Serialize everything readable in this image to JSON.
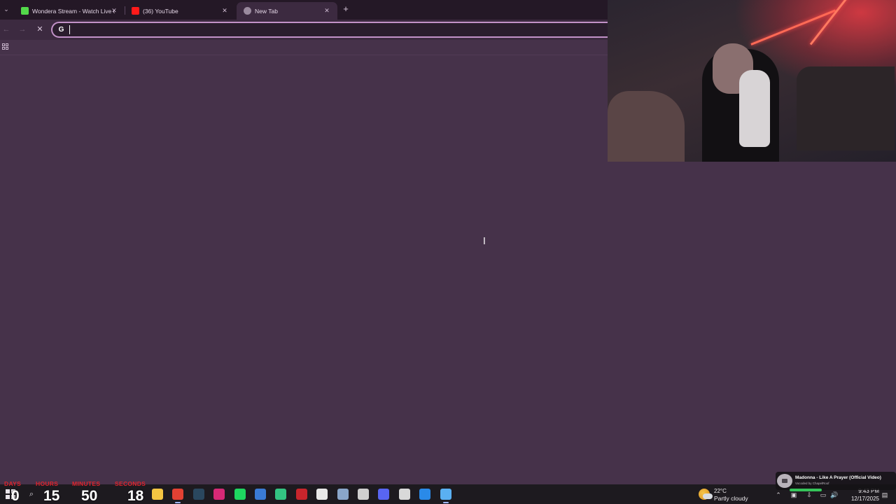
{
  "browser": {
    "tabs": [
      {
        "title": "Wondera Stream - Watch Live o",
        "active": false,
        "favicon_color": "#53d94a"
      },
      {
        "title": "(36) YouTube",
        "active": false,
        "favicon_color": "#ff1a1a"
      },
      {
        "title": "New Tab",
        "active": true,
        "favicon_color": "#9a8a9e"
      }
    ],
    "tab_close_glyph": "✕",
    "new_tab_glyph": "+",
    "tab_search_glyph": "⌄",
    "toolbar": {
      "back_glyph": "←",
      "forward_glyph": "→",
      "stop_glyph": "✕",
      "omnibox_value": "",
      "omnibox_icon_letter": "G"
    }
  },
  "page": {
    "background": "#46324a",
    "cursor_glyph": "I"
  },
  "countdown": {
    "labels": {
      "days": "DAYS",
      "hours": "HOURS",
      "minutes": "MINUTES",
      "seconds": "SECONDS"
    },
    "values": {
      "days": "0",
      "hours": "15",
      "minutes": "50",
      "seconds": "18"
    },
    "color": "#e0242c"
  },
  "taskbar": {
    "apps": [
      {
        "name": "file-explorer-icon",
        "color": "#f4c542",
        "active": false
      },
      {
        "name": "chrome-icon",
        "color": "#e34133",
        "active": true
      },
      {
        "name": "steam-icon",
        "color": "#2a475e",
        "active": false
      },
      {
        "name": "instagram-icon",
        "color": "#d62976",
        "active": false
      },
      {
        "name": "spotify-icon",
        "color": "#1ed760",
        "active": false
      },
      {
        "name": "app-blue-icon",
        "color": "#3a7bd5",
        "active": false
      },
      {
        "name": "app-green-icon",
        "color": "#33c482",
        "active": false
      },
      {
        "name": "app-red-icon",
        "color": "#c8252c",
        "active": false
      },
      {
        "name": "app-c-icon",
        "color": "#e8e8e8",
        "active": false
      },
      {
        "name": "settings-icon",
        "color": "#8aa6c9",
        "active": false
      },
      {
        "name": "obs-icon",
        "color": "#cfcfcf",
        "active": false
      },
      {
        "name": "discord-icon",
        "color": "#5865f2",
        "active": false
      },
      {
        "name": "app-paint-icon",
        "color": "#d9d9d9",
        "active": false
      },
      {
        "name": "app-blue2-icon",
        "color": "#2a8ae8",
        "active": false
      },
      {
        "name": "notepad-icon",
        "color": "#5ab0f2",
        "active": true
      }
    ],
    "weather": {
      "temp": "22°C",
      "desc": "Partly cloudy"
    },
    "clock": {
      "time": "9:43 PM",
      "date": "12/17/2025"
    },
    "now_playing": {
      "title": "Madonna - Like A Prayer (Official Video)",
      "subtitle": "Vocoded by ChapelRoof"
    }
  }
}
